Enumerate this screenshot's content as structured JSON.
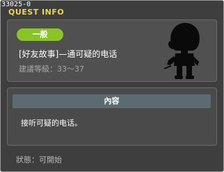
{
  "quest_id": "33025-0",
  "window_title": "QUEST INFO",
  "category_badge": "一般",
  "quest_name": "[好友故事]—通可疑的电话",
  "level_requirement": "建議等級：33～37",
  "content_header": "內容",
  "content_text": "接听可疑的电话。",
  "status_text": "狀態：可開始",
  "colors": {
    "title": "#f1d64a",
    "badge": "#8ac427",
    "panel": "#505050",
    "content_header": "#5c6b72"
  },
  "icons": {
    "npc_silhouette": "character-silhouette-icon"
  }
}
